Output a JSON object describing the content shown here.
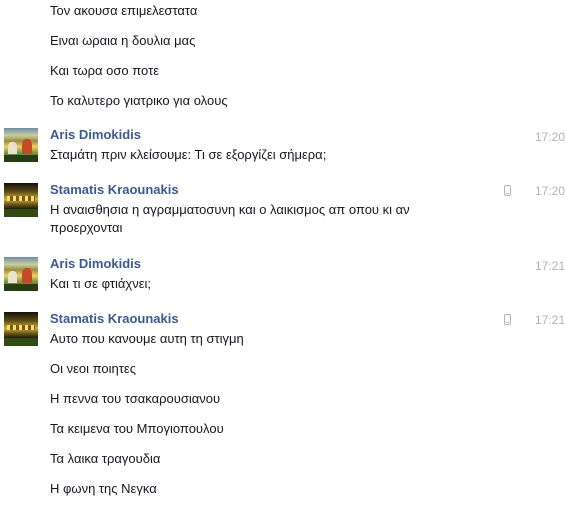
{
  "conversation": {
    "top_lines": [
      "Τον ακουσα επιμελεστατα",
      "Ειναι ωραια η δουλια μας",
      "Και τωρα οσο ποτε",
      "Το καλυτερο γιατρικο για ολους"
    ],
    "groups": [
      {
        "sender": "Aris Dimokidis",
        "time": "17:20",
        "mobile": false,
        "avatar": "avatar-photo-aris",
        "lines": [
          "Σταμάτη πριν κλείσουμε: Τι σε εξοργίζει σήμερα;"
        ]
      },
      {
        "sender": "Stamatis Kraounakis",
        "time": "17:20",
        "mobile": true,
        "avatar": "avatar-photo-stamatis",
        "lines": [
          "Η αναισθησια η αγραμματοσυνη και ο λαικισμος απ οπου κι αν",
          "προερχονται"
        ]
      },
      {
        "sender": "Aris Dimokidis",
        "time": "17:21",
        "mobile": false,
        "avatar": "avatar-photo-aris",
        "lines": [
          "Και τι σε φτιάχνει;"
        ]
      },
      {
        "sender": "Stamatis Kraounakis",
        "time": "17:21",
        "mobile": true,
        "avatar": "avatar-photo-stamatis",
        "lines": [
          "Αυτο που κανουμε αυτη τη στιγμη",
          "Οι νεοι ποιητες",
          "Η πεννα του τσακαρουσιανου",
          "Τα κειμενα του Μπογιοπουλου",
          "Τα λαικα τραγουδια",
          "Η φωνη της Νεγκα"
        ]
      }
    ]
  },
  "colors": {
    "sender_name": "#3b5998",
    "message_text": "#141823",
    "timestamp": "#b0b4bb"
  },
  "icons": {
    "mobile": "mobile-phone-icon"
  }
}
